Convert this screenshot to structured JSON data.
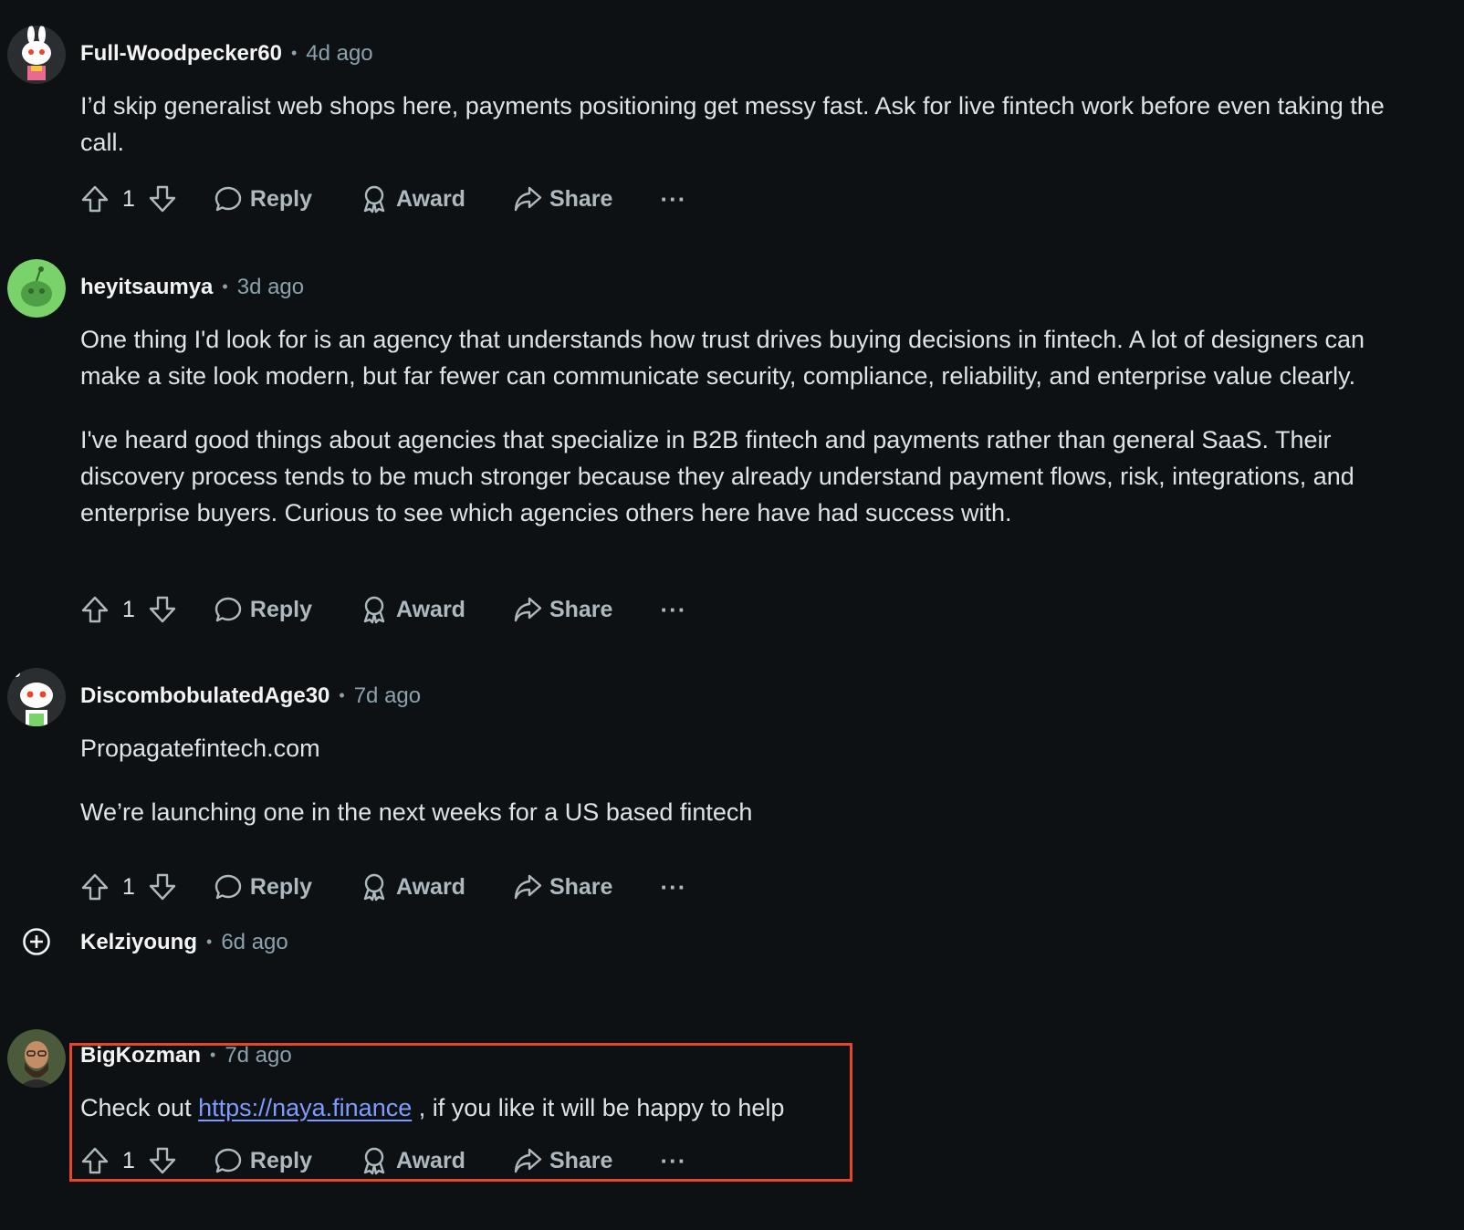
{
  "comments": [
    {
      "user": "Full-Woodpecker60",
      "time": "4d ago",
      "paragraphs": [
        "I’d skip generalist web shops here, payments positioning get messy fast. Ask for live fintech work before even taking the call."
      ],
      "votes": "1",
      "avatar_icon": "snoo-bunny-avatar-icon"
    },
    {
      "user": "heyitsaumya",
      "time": "3d ago",
      "paragraphs": [
        "One thing I'd look for is an agency that understands how trust drives buying decisions in fintech. A lot of designers can make a site look modern, but far fewer can communicate security, compliance, reliability, and enterprise value clearly.",
        "I've heard good things about agencies that specialize in B2B fintech and payments rather than general SaaS. Their discovery process tends to be much stronger because they already understand payment flows, risk, integrations, and enterprise buyers. Curious to see which agencies others here have had success with."
      ],
      "votes": "1",
      "avatar_icon": "green-snoo-avatar-icon"
    },
    {
      "user": "DiscombobulatedAge30",
      "time": "7d ago",
      "paragraphs": [
        "Propagatefintech.com",
        "We’re launching one in the next weeks for a US based fintech"
      ],
      "votes": "1",
      "avatar_icon": "default-snoo-avatar-icon"
    },
    {
      "user": "Kelziyoung",
      "time": "6d ago",
      "collapsed": true,
      "expand_icon": "plus-circle-icon"
    },
    {
      "user": "BigKozman",
      "time": "7d ago",
      "text_before_link": "Check out ",
      "link": "https://naya.finance",
      "text_after_link": " , if you like it will be happy to help",
      "votes": "1",
      "avatar_icon": "photo-avatar-icon"
    }
  ],
  "actions": {
    "reply": "Reply",
    "award": "Award",
    "share": "Share",
    "more": "···"
  },
  "colors": {
    "background": "#0e1113",
    "text": "#dfe3e6",
    "muted": "#8ba2ad",
    "link": "#7c9cff",
    "highlight_border": "#e8462a"
  }
}
